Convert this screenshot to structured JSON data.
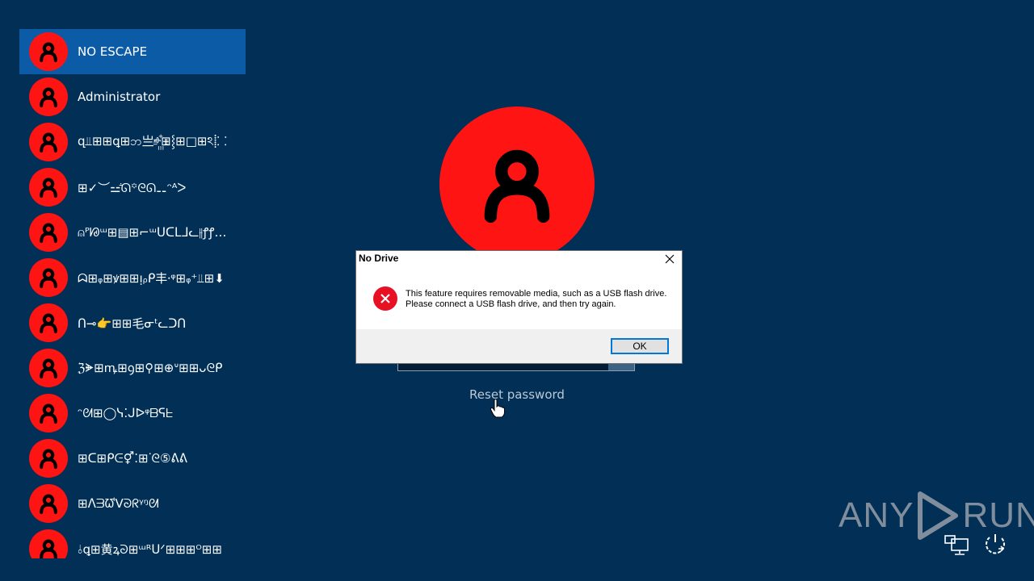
{
  "users": [
    {
      "name": "NO ESCAPE",
      "selected": true
    },
    {
      "name": "Administrator"
    },
    {
      "name": " զ⫫⊞⊞ꝗ⊞ဘ亗ⱚ꙲⊞⸾⊞□⊞ঽ⸽⸬"
    },
    {
      "name": "⊞✓︶⚍ꜙᘏ꙳ᘓᘏ⚋ᵔᴬᐳ"
    },
    {
      "name": "⍝ᴾᘘᵚ⊞▤⊞⌐ᵚᑌᑕᒪᒧᓚ⫲ꝭꝭ‿⌐⸬"
    },
    {
      "name": "ᗣ⊞ᵩ⊞ꝟ⊞⊞ᴉᵨᑭ丰⸱ᵠ⊞ᵩ⁺⫫⊞⬇"
    },
    {
      "name": "ᑎ⊸👉⊞⊞⽑ᓂᵗᓚᑐᑎ"
    },
    {
      "name": "ℨᗙ⊞ꝳ⊞ꝯ⊞⚲⊞⊕ᐡ⊞⊞ᴗᘓᑭ"
    },
    {
      "name": "ᵔᘛ⊞◯ᓭ⁚ᒍᐅᵠᗷᕋᖶ"
    },
    {
      "name": "⊞ᑕ⊞ᑭᕮ⚥⁚⊞ᐝᘓ⑤ᕕᕕ"
    },
    {
      "name": "⊞ᐱᗱᘺⅤᘐᖇᵞᵑᘛ"
    },
    {
      "name": "⫰ꝗ⊞黄ꝝᘐ⊞ᵚᴿᑌᐟ⊞⊞⊞ᴼ⊞⊞"
    }
  ],
  "password": {
    "value": ""
  },
  "reset_password_label": "Reset password",
  "dialog": {
    "title": "No Drive",
    "message_line1": "This feature requires removable media, such as a USB flash drive.",
    "message_line2": "Please connect a USB flash drive, and then try again.",
    "ok_label": "OK"
  },
  "watermark": {
    "left": "ANY",
    "right": "RUN"
  },
  "icons": [
    "user-icon",
    "error-icon",
    "close-icon",
    "hand-cursor-icon",
    "network-icon",
    "power-icon",
    "play-logo-icon"
  ],
  "colors": {
    "background": "#012f55",
    "avatar": "#ff1414",
    "selected": "#0b5ba6",
    "error": "#e81123",
    "button_border": "#0078d7"
  }
}
